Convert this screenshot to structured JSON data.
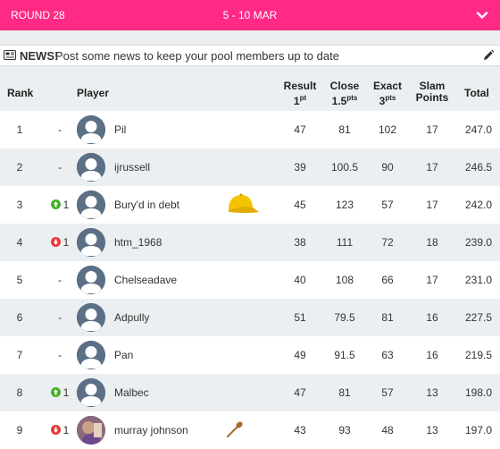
{
  "header": {
    "round": "ROUND 28",
    "dates": "5 - 10 MAR",
    "icon": "chevron-down-icon"
  },
  "news": {
    "bold": "NEWS!",
    "text": "Post some news to keep your pool members up to date",
    "icon": "newspaper-icon",
    "edit_icon": "pencil-icon"
  },
  "table": {
    "headers": {
      "rank": "Rank",
      "player": "Player",
      "result": "Result",
      "result_pts": "1",
      "result_sup": "pt",
      "close": "Close",
      "close_pts": "1.5",
      "close_sup": "pts",
      "exact": "Exact",
      "exact_pts": "3",
      "exact_sup": "pts",
      "slam_line1": "Slam",
      "slam_line2": "Points",
      "total": "Total"
    },
    "rows": [
      {
        "rank": "1",
        "move": "-",
        "move_dir": "none",
        "name": "Pil",
        "result": "47",
        "close": "81",
        "exact": "102",
        "slam": "17",
        "total": "247.0"
      },
      {
        "rank": "2",
        "move": "-",
        "move_dir": "none",
        "name": "ijrussell",
        "result": "39",
        "close": "100.5",
        "exact": "90",
        "slam": "17",
        "total": "246.5"
      },
      {
        "rank": "3",
        "move": "1",
        "move_dir": "up",
        "name": "Bury'd in debt",
        "badge": "yellow-cap-icon",
        "result": "45",
        "close": "123",
        "exact": "57",
        "slam": "17",
        "total": "242.0"
      },
      {
        "rank": "4",
        "move": "1",
        "move_dir": "down",
        "name": "htm_1968",
        "result": "38",
        "close": "111",
        "exact": "72",
        "slam": "18",
        "total": "239.0"
      },
      {
        "rank": "5",
        "move": "-",
        "move_dir": "none",
        "name": "Chelseadave",
        "result": "40",
        "close": "108",
        "exact": "66",
        "slam": "17",
        "total": "231.0"
      },
      {
        "rank": "6",
        "move": "-",
        "move_dir": "none",
        "name": "Adpully",
        "result": "51",
        "close": "79.5",
        "exact": "81",
        "slam": "16",
        "total": "227.5"
      },
      {
        "rank": "7",
        "move": "-",
        "move_dir": "none",
        "name": "Pan",
        "result": "49",
        "close": "91.5",
        "exact": "63",
        "slam": "16",
        "total": "219.5"
      },
      {
        "rank": "8",
        "move": "1",
        "move_dir": "up",
        "name": "Malbec",
        "result": "47",
        "close": "81",
        "exact": "57",
        "slam": "13",
        "total": "198.0"
      },
      {
        "rank": "9",
        "move": "1",
        "move_dir": "down",
        "name": "murray johnson",
        "badge": "wooden-spoon-icon",
        "avatar_photo": true,
        "result": "43",
        "close": "93",
        "exact": "48",
        "slam": "13",
        "total": "197.0"
      }
    ]
  },
  "colors": {
    "accent": "#ff2a85",
    "up": "#43b02a",
    "down": "#e53935",
    "avatar": "#5b6f85"
  }
}
